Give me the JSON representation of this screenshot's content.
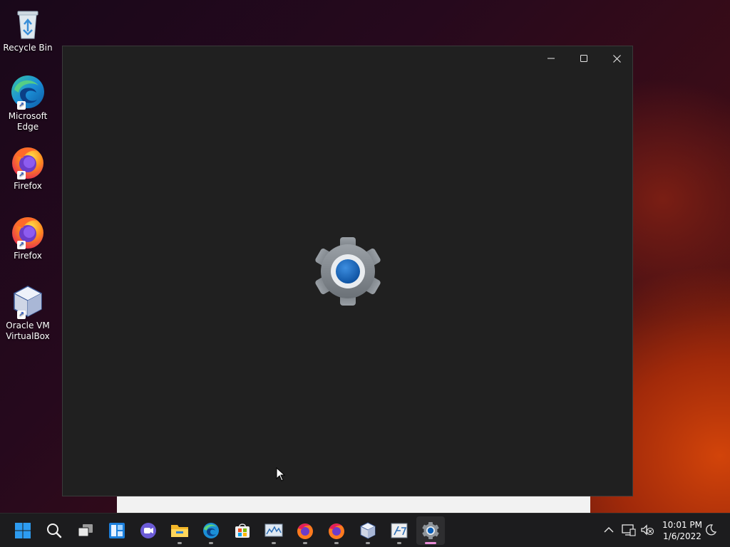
{
  "desktop": {
    "icons": [
      {
        "label": "Recycle Bin"
      },
      {
        "label": "Microsoft\nEdge"
      },
      {
        "label": "Firefox"
      },
      {
        "label": "Firefox"
      },
      {
        "label": "Oracle VM\nVirtualBox"
      }
    ]
  },
  "window": {
    "app": "Settings",
    "splash_icon": "settings-gear-icon",
    "minimize_icon": "minimize-icon",
    "maximize_icon": "maximize-icon",
    "close_icon": "close-icon"
  },
  "taskbar": {
    "apps": [
      "start-icon",
      "search-icon",
      "task-view-icon",
      "widgets-icon",
      "chat-icon",
      "file-explorer-icon",
      "edge-icon",
      "store-icon",
      "performance-monitor-icon",
      "firefox-icon",
      "firefox-icon",
      "virtualbox-icon",
      "calculator-icon",
      "settings-icon"
    ],
    "active_app": "settings-icon",
    "clock": {
      "time": "10:01 PM",
      "date": "1/6/2022"
    }
  },
  "colors": {
    "window_bg": "#202020",
    "taskbar_bg": "#1c1c1e",
    "active_indicator": "#e98ed8",
    "accent_blue": "#0067c0"
  }
}
